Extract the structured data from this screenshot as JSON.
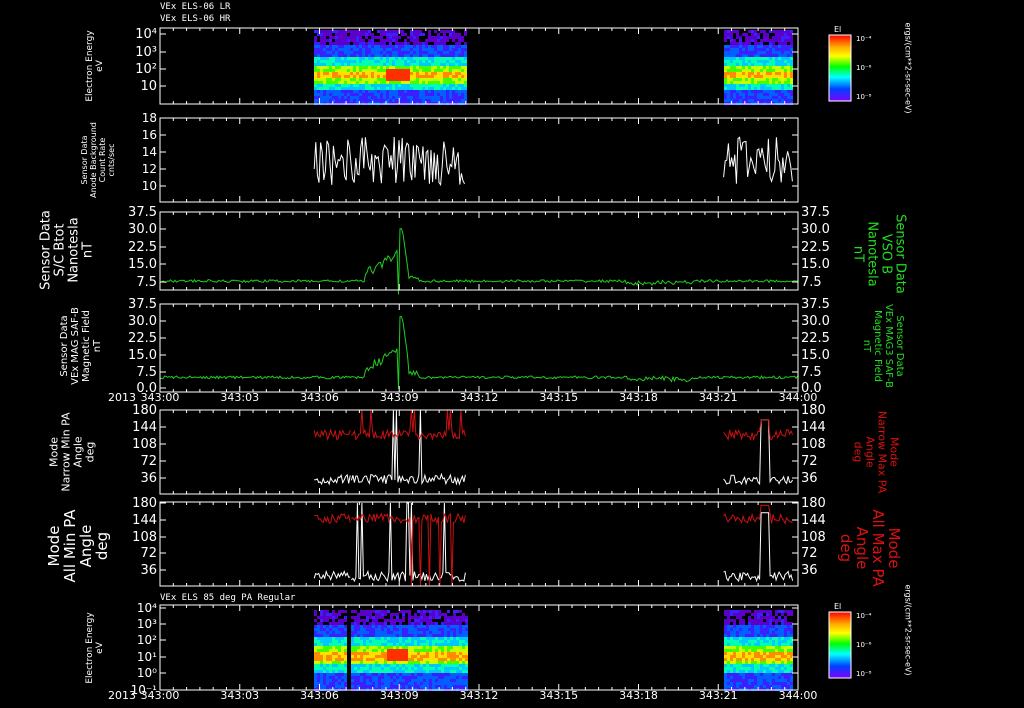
{
  "header": {
    "line1": "VEx ELS-06 LR",
    "line2": "VEx ELS-06 HR",
    "bottom_panel_title": "VEx ELS 85 deg PA Regular"
  },
  "time_axis": {
    "year": "2013",
    "ticks": [
      "343:00",
      "343:03",
      "343:06",
      "343:09",
      "343:12",
      "343:15",
      "343:18",
      "343:21",
      "344:00"
    ]
  },
  "colorbar": {
    "label": "El",
    "unit": "ergs/(cm**2-sr-sec-eV)",
    "ticks": [
      "10⁻⁴",
      "10⁻⁶",
      "10⁻⁸"
    ]
  },
  "colors": {
    "background": "#000000",
    "trace_white": "#ffffff",
    "trace_green": "#22cc22",
    "label_green": "#22dd22",
    "trace_red": "#cc1111",
    "label_red": "#dd1111"
  },
  "chart_data": [
    {
      "type": "heatmap",
      "panel": "electron_energy_lr_hr",
      "ylabel": [
        "Electron Energy",
        "eV"
      ],
      "yticks": [
        "10⁴",
        "10³",
        "10²",
        "10"
      ],
      "x_segments": [
        [
          "343:05.8",
          "343:11.5"
        ],
        [
          "343:21.2",
          "343:23.8"
        ]
      ],
      "colorbar_label": "El"
    },
    {
      "type": "line",
      "panel": "background_count_rate",
      "ylabel": [
        "Sensor Data",
        "Anode Background",
        "Count Rate",
        "cnts/sec"
      ],
      "ylim": [
        9,
        18
      ],
      "yticks": [
        "18",
        "16",
        "14",
        "12",
        "10"
      ],
      "series": [
        {
          "color": "white",
          "x_segments": [
            [
              "343:05.8",
              "343:11.5"
            ],
            [
              "343:21.2",
              "343:23.8"
            ]
          ],
          "range": [
            10,
            16.5
          ]
        }
      ]
    },
    {
      "type": "line",
      "panel": "bmag_sc",
      "ylabel": [
        "Sensor Data",
        "S/C Btot",
        "Nanotesla",
        "nT"
      ],
      "right_label": [
        "Sensor Data",
        "VSO B",
        "Nanotesla",
        "nT"
      ],
      "ylim": [
        0,
        37.5
      ],
      "yticks": [
        "37.5",
        "30.0",
        "22.5",
        "15.0",
        "7.5"
      ],
      "series": [
        {
          "color": "green",
          "baseline": 6.5,
          "peak": {
            "x": "343:09.0",
            "y": 30
          }
        }
      ]
    },
    {
      "type": "line",
      "panel": "bmag_saf",
      "ylabel": [
        "Sensor Data",
        "VEx MAG SAF-B",
        "Magnetic Field",
        "nT"
      ],
      "right_label": [
        "Sensor Data",
        "VEx MAG3 SAF-B",
        "Magnetic Field",
        "nT"
      ],
      "ylim": [
        0,
        37.5
      ],
      "yticks": [
        "37.5",
        "30.0",
        "22.5",
        "15.0",
        "7.5",
        "0.0"
      ],
      "series": [
        {
          "color": "green",
          "baseline": 5.5,
          "peak": {
            "x": "343:09.0",
            "y": 32
          }
        }
      ]
    },
    {
      "type": "line",
      "panel": "narrow_pitch_angle",
      "ylabel": [
        "Mode",
        "Narrow Min PA",
        "Angle",
        "deg"
      ],
      "right_label": [
        "Mode",
        "Narrow Max PA",
        "Angle",
        "deg"
      ],
      "ylim": [
        0,
        180
      ],
      "yticks": [
        "180",
        "144",
        "108",
        "72",
        "36"
      ],
      "series": [
        {
          "name": "Narrow Min PA",
          "color": "white",
          "typical": 40
        },
        {
          "name": "Narrow Max PA",
          "color": "red",
          "typical": 130
        }
      ]
    },
    {
      "type": "line",
      "panel": "all_pitch_angle",
      "ylabel": [
        "Mode",
        "All Min PA",
        "Angle",
        "deg"
      ],
      "right_label": [
        "Mode",
        "All Max PA",
        "Angle",
        "deg"
      ],
      "ylim": [
        0,
        180
      ],
      "yticks": [
        "180",
        "144",
        "108",
        "72",
        "36"
      ],
      "series": [
        {
          "name": "All Min PA",
          "color": "white",
          "typical": 30
        },
        {
          "name": "All Max PA",
          "color": "red",
          "typical": 148
        }
      ]
    },
    {
      "type": "heatmap",
      "panel": "electron_energy_85deg",
      "title": "VEx ELS 85 deg PA Regular",
      "ylabel": [
        "Electron Energy",
        "eV"
      ],
      "yticks": [
        "10⁴",
        "10³",
        "10²",
        "10¹",
        "10⁰",
        "10⁻¹"
      ],
      "x_segments": [
        [
          "343:05.8",
          "343:07.0"
        ],
        [
          "343:07.2",
          "343:11.5"
        ],
        [
          "343:21.2",
          "343:23.8"
        ]
      ],
      "colorbar_label": "El"
    }
  ]
}
